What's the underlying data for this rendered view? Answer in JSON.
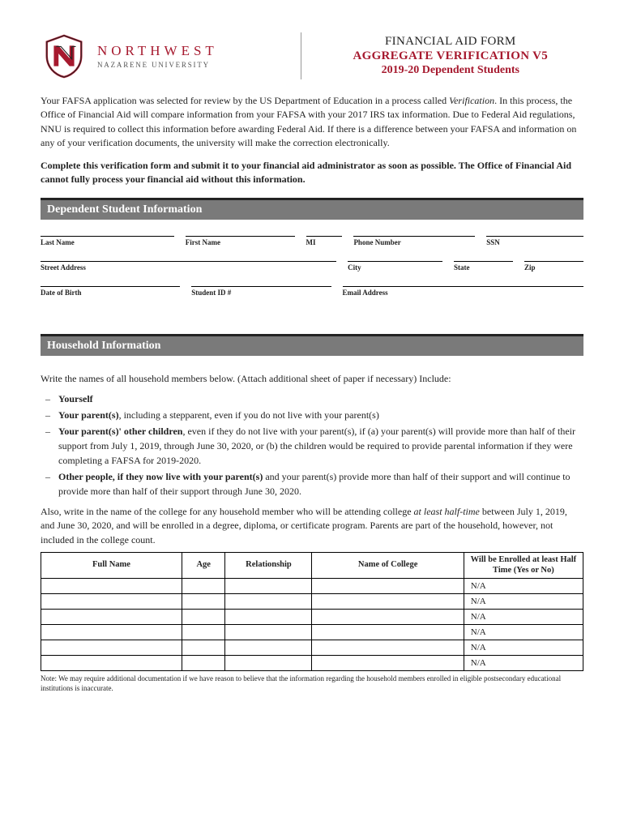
{
  "header": {
    "uni_main": "NORTHWEST",
    "uni_sub": "NAZARENE UNIVERSITY",
    "title1": "FINANCIAL AID FORM",
    "title2": "AGGREGATE VERIFICATION V5",
    "title3": "2019-20 Dependent Students"
  },
  "intro": {
    "p1_a": "Your FAFSA application was selected for review by the US Department of Education in a process called ",
    "p1_i": "Verification",
    "p1_b": ". In this process, the Office of Financial Aid will compare information from your FAFSA with your 2017 IRS tax information. Due to Federal Aid regulations, NNU is required to collect this information before awarding Federal Aid. If there is a difference between your FAFSA and information on any of your verification documents, the university will make the correction electronically.",
    "p2": "Complete this verification form and submit it to your financial aid administrator as soon as possible. The Office of Financial Aid cannot fully process your financial aid without this information."
  },
  "section1": {
    "title": "Dependent Student Information",
    "fields_row1": [
      "Last Name",
      "First Name",
      "MI",
      "Phone Number",
      "SSN"
    ],
    "fields_row2": [
      "Street Address",
      "City",
      "State",
      "Zip"
    ],
    "fields_row3": [
      "Date of Birth",
      "Student ID #",
      "Email Address"
    ]
  },
  "section2": {
    "title": "Household Information",
    "intro": "Write the names of all household members below. (Attach additional sheet of paper if necessary)  Include:",
    "items": [
      {
        "bold": "Yourself",
        "rest": ""
      },
      {
        "bold": "Your parent(s)",
        "rest": ", including a stepparent, even if you do not live with your parent(s)"
      },
      {
        "bold": "Your parent(s)' other children",
        "rest": ", even if they do not live with your parent(s), if (a) your parent(s) will provide more than half of their support from July 1, 2019, through June 30, 2020, or (b) the children would be required to provide parental information if they were completing a FAFSA for 2019-2020."
      },
      {
        "bold": "Other people, if they now live with your parent(s)",
        "rest": " and your parent(s) provide more than half of their support and will continue to provide more than half of their support through June 30, 2020."
      }
    ],
    "also_a": "Also, write in the name of the college for any household member who will be attending college ",
    "also_i": "at least half-time",
    "also_b": " between July 1, 2019, and June 30, 2020, and will be enrolled in a degree, diploma, or certificate program. Parents are part of the household, however, not included in the college count.",
    "table": {
      "headers": [
        "Full Name",
        "Age",
        "Relationship",
        "Name of College",
        "Will be Enrolled at least Half Time (Yes or No)"
      ],
      "na": "N/A"
    },
    "note": "Note: We may require additional documentation if we have reason to believe that the information regarding the household members enrolled in eligible postsecondary educational institutions is inaccurate."
  }
}
